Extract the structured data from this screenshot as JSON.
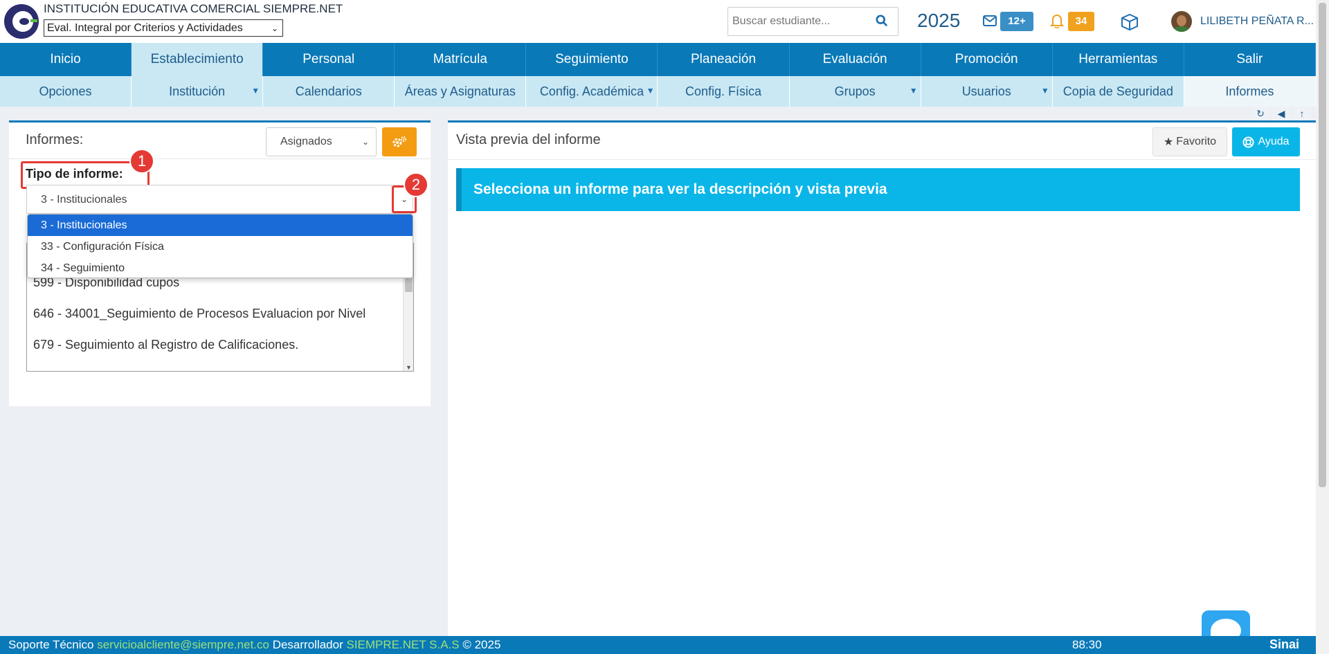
{
  "header": {
    "institution": "INSTITUCIÓN EDUCATIVA COMERCIAL SIEMPRE.NET",
    "mode_value": "Eval. Integral por Criterios y Actividades",
    "search_placeholder": "Buscar estudiante...",
    "year": "2025",
    "mail_badge": "12+",
    "notif_badge": "34",
    "user": "LILIBETH PEÑATA R..."
  },
  "nav_main": [
    "Inicio",
    "Establecimiento",
    "Personal",
    "Matrícula",
    "Seguimiento",
    "Planeación",
    "Evaluación",
    "Promoción",
    "Herramientas",
    "Salir"
  ],
  "nav_sub": [
    "Opciones",
    "Institución",
    "Calendarios",
    "Áreas y Asignaturas",
    "Config. Académica",
    "Config. Física",
    "Grupos",
    "Usuarios",
    "Copia de Seguridad",
    "Informes"
  ],
  "left": {
    "title": "Informes:",
    "filter_value": "Asignados",
    "tipo_label": "Tipo de informe:",
    "tipo_value": "3 - Institucionales",
    "annotation_1": "1",
    "annotation_2": "2",
    "options": [
      "3 - Institucionales",
      "33 - Configuración Física",
      "34 - Seguimiento"
    ],
    "reports": [
      "599 - Disponibilidad cupos",
      "646 - 34001_Seguimiento de Procesos Evaluacion por Nivel",
      "679 - Seguimiento al Registro de Calificaciones."
    ]
  },
  "right": {
    "title": "Vista previa del informe",
    "favorite_label": "Favorito",
    "help_label": "Ayuda",
    "info_message": "Selecciona un informe para ver la descripción y vista previa"
  },
  "footer": {
    "support_label": "Soporte Técnico",
    "support_email": "servicioalcliente@siempre.net.co",
    "dev_label": "Desarrollador",
    "dev_name": "SIEMPRE.NET S.A.S",
    "copyright": "© 2025",
    "timer": "88:30",
    "brand": "Sinai"
  },
  "colors": {
    "primary": "#0a79b8",
    "accent": "#0ab6e8",
    "warning": "#f39c12",
    "annotation": "#e53935"
  }
}
